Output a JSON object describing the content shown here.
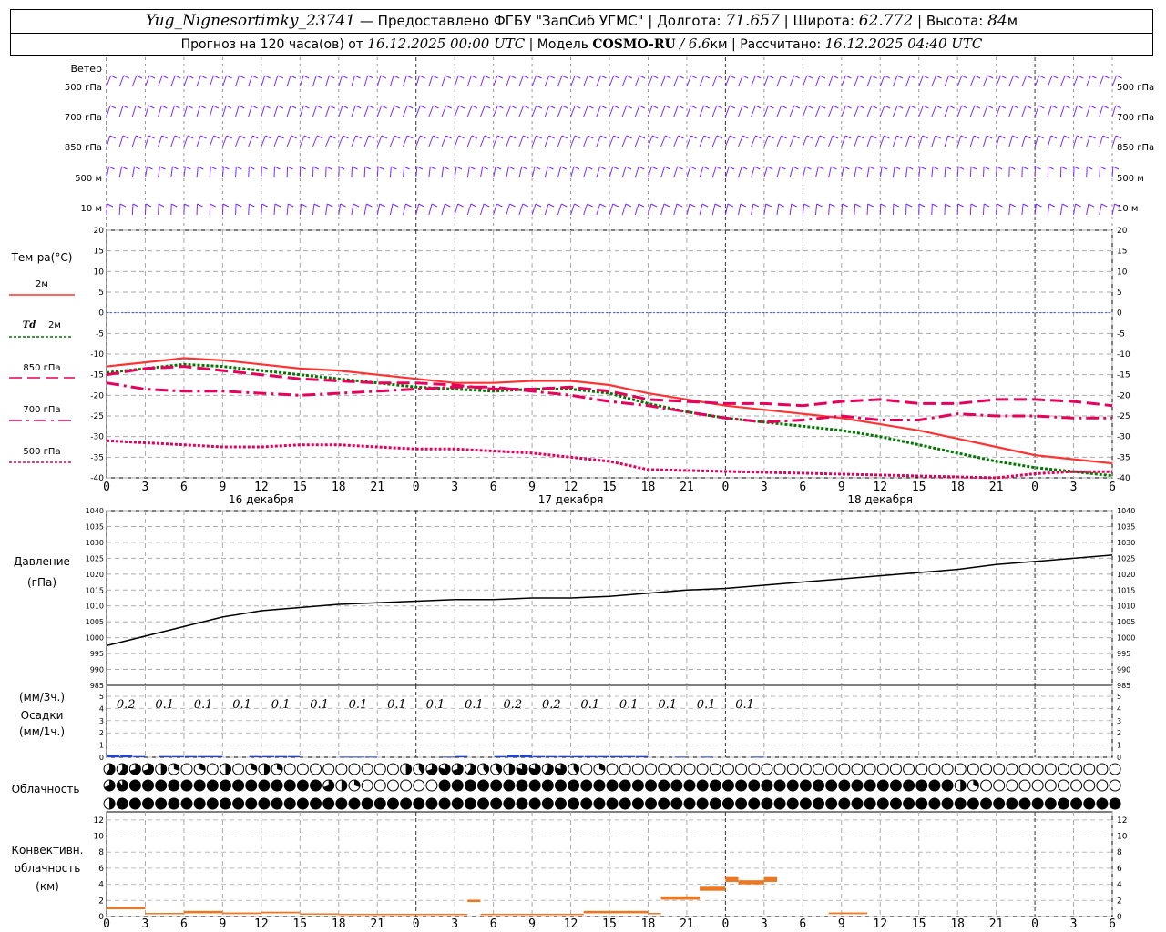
{
  "header": {
    "station": "Yug_Nignesortimky_23741",
    "provider": "— Предоставлено ФГБУ \"ЗапСиб УГМС\"",
    "lon_label": "| Долгота:",
    "lon": "71.657",
    "lat_label": "| Широта:",
    "lat": "62.772",
    "alt_label": "| Высота:",
    "alt": "84",
    "alt_unit": "м",
    "forecast_label": "Прогноз на 120 часа(ов) от",
    "forecast_from": "16.12.2025 00:00 UTC",
    "model_label": "| Модель",
    "model": "COSMO-RU",
    "resolution_sep": "/",
    "resolution": "6.6",
    "resolution_unit": "км",
    "calc_label": "| Рассчитано:",
    "calc_time": "16.12.2025 04:40 UTC"
  },
  "time_axis": {
    "hour_labels": [
      "0",
      "3",
      "6",
      "9",
      "12",
      "15",
      "18",
      "21",
      "0",
      "3",
      "6",
      "9",
      "12",
      "15",
      "18",
      "21",
      "0",
      "3",
      "6",
      "9",
      "12",
      "15",
      "18",
      "21",
      "0",
      "3",
      "6"
    ],
    "day_labels": [
      "16 декабря",
      "17 декабря",
      "18 декабря"
    ]
  },
  "wind_panel": {
    "title": "Ветер",
    "levels": [
      "500 гПа",
      "700 гПа",
      "850 гПа",
      "500 м",
      "10 м"
    ]
  },
  "chart_data": [
    {
      "type": "line",
      "title": "Тем-ра(°C)",
      "x_unit": "hours from 16.12.2025 00:00 UTC",
      "ylim": [
        -40,
        20
      ],
      "yticks": [
        20,
        15,
        10,
        5,
        0,
        -5,
        -10,
        -15,
        -20,
        -25,
        -30,
        -35,
        -40
      ],
      "grid": true,
      "series": [
        {
          "name": "2м",
          "color": "#ff3333",
          "style": "solid",
          "x": [
            0,
            3,
            6,
            9,
            12,
            15,
            18,
            21,
            24,
            27,
            30,
            33,
            36,
            39,
            42,
            45,
            48,
            51,
            54,
            57,
            60,
            63,
            66,
            69,
            72,
            75,
            78
          ],
          "y": [
            -13,
            -12,
            -11,
            -11.5,
            -12.5,
            -13.5,
            -14,
            -15,
            -16,
            -17,
            -17,
            -16.5,
            -16.5,
            -17.5,
            -19.5,
            -21,
            -22.5,
            -23.5,
            -24.5,
            -25.5,
            -27,
            -28.5,
            -30.5,
            -32.5,
            -34.5,
            -35.5,
            -36.5
          ]
        },
        {
          "name": "Td 2м",
          "color": "#007700",
          "style": "dotted",
          "x": [
            0,
            3,
            6,
            9,
            12,
            15,
            18,
            21,
            24,
            27,
            30,
            33,
            36,
            39,
            42,
            45,
            48,
            51,
            54,
            57,
            60,
            63,
            66,
            69,
            72,
            75,
            78
          ],
          "y": [
            -14.5,
            -13.5,
            -12.5,
            -13,
            -14,
            -15,
            -16,
            -17,
            -18,
            -18.5,
            -19,
            -18.5,
            -18.5,
            -19.5,
            -22,
            -24,
            -25.5,
            -26.5,
            -27.5,
            -28.5,
            -30,
            -32,
            -34,
            -36,
            -37.5,
            -38.5,
            -39.5
          ]
        },
        {
          "name": "850 гПа",
          "color": "#e6005c",
          "style": "dashed",
          "x": [
            0,
            3,
            6,
            9,
            12,
            15,
            18,
            21,
            24,
            27,
            30,
            33,
            36,
            39,
            42,
            45,
            48,
            51,
            54,
            57,
            60,
            63,
            66,
            69,
            72,
            75,
            78
          ],
          "y": [
            -15,
            -13.5,
            -13,
            -14,
            -15,
            -16,
            -16.5,
            -17,
            -17,
            -17.5,
            -18.5,
            -18.5,
            -18,
            -19,
            -21,
            -21.5,
            -22,
            -22,
            -22.5,
            -21.5,
            -21,
            -22,
            -22,
            -21,
            -21,
            -21.5,
            -22.5
          ]
        },
        {
          "name": "700 гПа",
          "color": "#e6005c",
          "style": "dashdot",
          "x": [
            0,
            3,
            6,
            9,
            12,
            15,
            18,
            21,
            24,
            27,
            30,
            33,
            36,
            39,
            42,
            45,
            48,
            51,
            54,
            57,
            60,
            63,
            66,
            69,
            72,
            75,
            78
          ],
          "y": [
            -17,
            -18.5,
            -19,
            -19,
            -19.5,
            -20,
            -19.5,
            -19,
            -18.5,
            -18,
            -18,
            -19,
            -20,
            -21.5,
            -22.5,
            -24,
            -25.5,
            -26.5,
            -26,
            -25,
            -26,
            -26,
            -24.5,
            -25,
            -25,
            -25.5,
            -25.5
          ]
        },
        {
          "name": "500 гПа",
          "color": "#e6005c",
          "style": "dotted",
          "x": [
            0,
            3,
            6,
            9,
            12,
            15,
            18,
            21,
            24,
            27,
            30,
            33,
            36,
            39,
            42,
            45,
            48,
            51,
            54,
            57,
            60,
            63,
            66,
            69,
            72,
            75,
            78
          ],
          "y": [
            -31,
            -31.5,
            -32,
            -32.5,
            -32.5,
            -32,
            -32,
            -32.5,
            -33,
            -33,
            -33.5,
            -34,
            -35,
            -36,
            -38,
            -41,
            -45,
            -46,
            -46,
            -45,
            -44,
            -42,
            -41,
            -40,
            -39,
            -38.5,
            -38.5
          ]
        }
      ]
    },
    {
      "type": "line",
      "title": "Давление",
      "ylabel": "(гПа)",
      "ylim": [
        985,
        1040
      ],
      "yticks": [
        1040,
        1035,
        1030,
        1025,
        1020,
        1015,
        1010,
        1005,
        1000,
        995,
        990,
        985
      ],
      "grid": true,
      "series": [
        {
          "color": "#000000",
          "x": [
            0,
            3,
            6,
            9,
            12,
            15,
            18,
            21,
            24,
            27,
            30,
            33,
            36,
            39,
            42,
            45,
            48,
            51,
            54,
            57,
            60,
            63,
            66,
            69,
            72,
            75,
            78
          ],
          "y": [
            997.5,
            1000.5,
            1003.5,
            1006.5,
            1008.5,
            1009.5,
            1010.5,
            1011,
            1011.5,
            1012,
            1012,
            1012.5,
            1012.5,
            1013,
            1014,
            1015,
            1015.5,
            1016.5,
            1017.5,
            1018.5,
            1019.5,
            1020.5,
            1021.5,
            1023,
            1024,
            1025,
            1026
          ]
        }
      ]
    },
    {
      "type": "bar",
      "title": "Осадки",
      "ylabel_top": "(мм/3ч.)",
      "ylabel_bottom": "(мм/1ч.)",
      "ylim": [
        0,
        5
      ],
      "yticks": [
        5,
        4,
        3,
        2,
        1,
        0
      ],
      "accum_labels": [
        "0.2",
        "0.1",
        "0.1",
        "0.1",
        "0.1",
        "0.1",
        "0.1",
        "0.1",
        "0.1",
        "0.1",
        "0.2",
        "0.2",
        "0.1",
        "0.1",
        "0.1",
        "0.1",
        "0.1"
      ],
      "hourly_x": [
        1,
        2,
        3,
        5,
        6,
        7,
        8,
        9,
        12,
        13,
        14,
        15,
        19,
        20,
        21,
        27,
        28,
        31,
        32,
        33,
        34,
        35,
        36,
        37,
        38,
        39,
        40,
        41,
        42,
        45,
        47,
        51
      ],
      "hourly_y": [
        0.2,
        0.2,
        0.1,
        0.1,
        0.1,
        0.1,
        0.1,
        0.1,
        0.1,
        0.1,
        0.1,
        0.1,
        0.05,
        0.05,
        0.05,
        0.05,
        0.1,
        0.1,
        0.2,
        0.2,
        0.1,
        0.1,
        0.1,
        0.1,
        0.1,
        0.1,
        0.1,
        0.1,
        0.1,
        0.05,
        0.05,
        0.05
      ],
      "color": "#2244cc"
    },
    {
      "type": "table",
      "title": "Облачность",
      "note": "cover fraction 0..1 per hour; rows top to bottom",
      "rows": [
        [
          0.6,
          0.6,
          0.7,
          0.7,
          0.5,
          0.3,
          0,
          0.3,
          0,
          0.5,
          0,
          0.3,
          0.5,
          0.3,
          0,
          0,
          0,
          0,
          0,
          0,
          0,
          0,
          0,
          0.5,
          0.4,
          0.7,
          0.8,
          0.7,
          0.6,
          0.4,
          0.4,
          0.5,
          0.8,
          0.8,
          0.6,
          0.8,
          0.4,
          0,
          0.3,
          0,
          0,
          0,
          0,
          0,
          0,
          0,
          0,
          0,
          0,
          0,
          0,
          0,
          0,
          0,
          0,
          0,
          0,
          0,
          0,
          0,
          0,
          0,
          0,
          0,
          0,
          0,
          0,
          0,
          0,
          0,
          0,
          0,
          0,
          0,
          0,
          0,
          0,
          0,
          0
        ],
        [
          0.7,
          0.9,
          1,
          1,
          1,
          1,
          1,
          1,
          1,
          1,
          1,
          1,
          1,
          1,
          1,
          1,
          1,
          0.7,
          0.5,
          0.3,
          0,
          0,
          0,
          0,
          0,
          0,
          1,
          1,
          1,
          1,
          1,
          1,
          1,
          1,
          1,
          1,
          1,
          1,
          1,
          1,
          1,
          1,
          1,
          1,
          1,
          1,
          1,
          1,
          1,
          1,
          1,
          1,
          1,
          1,
          1,
          1,
          1,
          1,
          1,
          1,
          1,
          1,
          1,
          1,
          1,
          1,
          0.5,
          0.3,
          0,
          0,
          0,
          0,
          0,
          0,
          0,
          0,
          0,
          0,
          0
        ],
        [
          0.5,
          1,
          1,
          1,
          1,
          1,
          1,
          1,
          1,
          1,
          1,
          1,
          1,
          1,
          1,
          1,
          1,
          1,
          1,
          1,
          1,
          1,
          1,
          1,
          1,
          1,
          1,
          1,
          1,
          1,
          1,
          1,
          1,
          1,
          1,
          1,
          1,
          1,
          1,
          1,
          1,
          1,
          1,
          1,
          1,
          1,
          1,
          1,
          1,
          1,
          1,
          1,
          1,
          1,
          1,
          1,
          1,
          1,
          1,
          1,
          1,
          1,
          1,
          1,
          1,
          1,
          1,
          1,
          1,
          1,
          1,
          1,
          1,
          1,
          1,
          1,
          1,
          1,
          1
        ]
      ]
    },
    {
      "type": "bar",
      "title": "Конвективн.",
      "title2": "облачность",
      "ylabel": "(км)",
      "ylim": [
        0,
        13
      ],
      "yticks": [
        12,
        10,
        8,
        6,
        4,
        2,
        0
      ],
      "segments": [
        {
          "x0": 0,
          "x1": 3,
          "base": 0.9,
          "top": 1.2
        },
        {
          "x0": 3,
          "x1": 6,
          "base": 0.3,
          "top": 0.45
        },
        {
          "x0": 6,
          "x1": 9,
          "base": 0.4,
          "top": 0.7
        },
        {
          "x0": 9,
          "x1": 12,
          "base": 0.3,
          "top": 0.5
        },
        {
          "x0": 12,
          "x1": 15,
          "base": 0.4,
          "top": 0.6
        },
        {
          "x0": 15,
          "x1": 18,
          "base": 0.3,
          "top": 0.4
        },
        {
          "x0": 18,
          "x1": 24,
          "base": 0.2,
          "top": 0.35
        },
        {
          "x0": 24,
          "x1": 28,
          "base": 0.2,
          "top": 0.35
        },
        {
          "x0": 28,
          "x1": 29,
          "base": 1.8,
          "top": 2.1
        },
        {
          "x0": 29,
          "x1": 37,
          "base": 0.2,
          "top": 0.35
        },
        {
          "x0": 37,
          "x1": 42,
          "base": 0.4,
          "top": 0.7
        },
        {
          "x0": 42,
          "x1": 43,
          "base": 0.3,
          "top": 0.45
        },
        {
          "x0": 43,
          "x1": 46,
          "base": 2.1,
          "top": 2.5
        },
        {
          "x0": 46,
          "x1": 48,
          "base": 3.2,
          "top": 3.7
        },
        {
          "x0": 48,
          "x1": 49,
          "base": 4.3,
          "top": 4.9
        },
        {
          "x0": 49,
          "x1": 51,
          "base": 4.0,
          "top": 4.5
        },
        {
          "x0": 51,
          "x1": 52,
          "base": 4.3,
          "top": 4.9
        },
        {
          "x0": 56,
          "x1": 59,
          "base": 0.3,
          "top": 0.5
        }
      ],
      "color": "#ee7722"
    }
  ],
  "legend": {
    "t2m": "2м",
    "td_prefix": "Td",
    "td": "2м",
    "p850": "850 гПа",
    "p700": "700 гПа",
    "p500": "500 гПа"
  },
  "colors": {
    "wind": "#7a2aff",
    "t2m": "#ff3333",
    "td": "#007700",
    "upper": "#e6005c",
    "zero_line": "#3355ff",
    "pressure": "#000000",
    "precip": "#2244cc",
    "convective": "#ee7722"
  }
}
